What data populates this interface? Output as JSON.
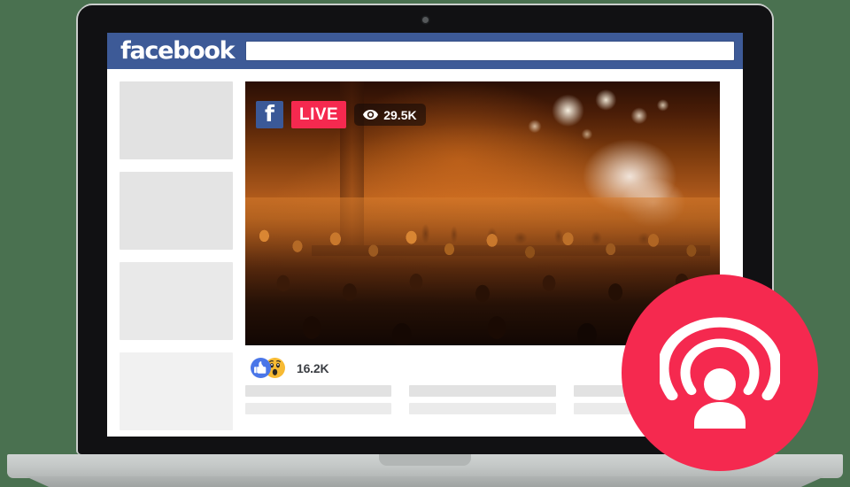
{
  "scene": {
    "background_color": "#4a7150",
    "device": "laptop-mockup"
  },
  "facebook": {
    "logo_text": "facebook",
    "brand_color": "#3d5a97",
    "search": {
      "value": "",
      "placeholder": ""
    }
  },
  "sidebar": {
    "placeholder_blocks": [
      {
        "name": "sidebar-placeholder-1"
      },
      {
        "name": "sidebar-placeholder-2"
      },
      {
        "name": "sidebar-placeholder-3"
      },
      {
        "name": "sidebar-placeholder-4"
      }
    ]
  },
  "video_post": {
    "image_description": "concert stage with orange lighting, smoke and a large silhouetted crowd",
    "live_badge": {
      "facebook_mark": "f",
      "live_label": "LIVE",
      "live_color": "#f5294f",
      "facebook_mark_color": "#3b5998",
      "viewers_icon": "eye-icon",
      "viewers_count": "29.5K"
    },
    "reactions": {
      "icons": [
        "thumbs-up-icon",
        "wow-face-icon"
      ],
      "like_color": "#4a76e8",
      "wow_color": "#f7ba33",
      "count": "16.2K"
    }
  },
  "content_placeholders": {
    "rows": [
      {
        "name": "content-bar-row-1",
        "bars": 3
      },
      {
        "name": "content-bar-row-2",
        "bars": 3
      }
    ]
  },
  "live_badge_overlay": {
    "icon": "live-broadcast-person-icon",
    "color": "#f5294f"
  }
}
